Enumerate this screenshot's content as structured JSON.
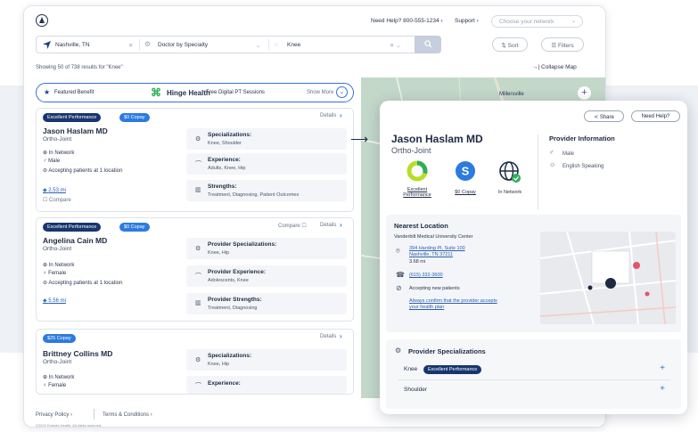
{
  "header": {
    "need_help": "Need Help? 800-555-1234",
    "support": "Support",
    "network_placeholder": "Choose your network"
  },
  "search": {
    "location": "Nashville, TN",
    "type": "Doctor by Specialty",
    "query": "Knee",
    "sort_label": "Sort",
    "filters_label": "Filters"
  },
  "results": {
    "summary": "Showing 50 of 738 results for \"Knee\"",
    "collapse_map": "Collapse Map"
  },
  "featured": {
    "label": "Featured Benefit",
    "brand": "Hinge Health",
    "description": "Free Digital PT Sessions",
    "show_more": "Show More"
  },
  "map": {
    "town": "Millersville"
  },
  "cards": [
    {
      "badges": [
        "Excellent Performance",
        "$0 Copay"
      ],
      "details": "Details",
      "name": "Jason Haslam MD",
      "specialty": "Ortho-Joint",
      "network": "In Network",
      "gender": "Male",
      "accepting": "Accepting patients at 1 location",
      "distance": "2.53 mi",
      "compare": "Compare",
      "spec_title": "Specializations:",
      "spec_val": "Knee, Shoulder",
      "exp_title": "Experience:",
      "exp_val": "Adults, Knee, Hip",
      "str_title": "Strengths:",
      "str_val": "Treatment, Diagnosing, Patient Outcomes"
    },
    {
      "badges": [
        "Excellent Performance",
        "$0 Copay"
      ],
      "details": "Details",
      "compare": "Compare",
      "name": "Angelina Cain MD",
      "specialty": "Ortho-Joint",
      "network": "In Network",
      "gender": "Female",
      "accepting": "Accepting patients at 1 location",
      "distance": "5.56 mi",
      "spec_title": "Provider Specializations:",
      "spec_val": "Knee, Hip",
      "exp_title": "Provider Experience:",
      "exp_val": "Adolescents, Knee",
      "str_title": "Provider Strengths:",
      "str_val": "Treatment, Diagnosing"
    },
    {
      "badges": [
        "$25 Copay"
      ],
      "details": "Details",
      "name": "Brittney Collins MD",
      "specialty": "Ortho-Joint",
      "network": "In Network",
      "gender": "Female",
      "spec_title": "Specializations:",
      "spec_val": "Knee, Hip",
      "exp_title": "Experience:"
    }
  ],
  "footer": {
    "privacy": "Privacy Policy",
    "terms": "Terms & Conditions",
    "copyright": "©2022 Embold Health. All rights reserved."
  },
  "panel": {
    "share": "Share",
    "need_help": "Need Help?",
    "name": "Jason Haslam MD",
    "specialty": "Ortho-Joint",
    "stats": [
      {
        "caption": "Excellent Performance"
      },
      {
        "caption": "$0 Copay"
      },
      {
        "caption": "In Network"
      }
    ],
    "info_title": "Provider Information",
    "gender": "Male",
    "language": "English Speaking",
    "nearest_title": "Nearest Location",
    "center": "Vanderbilt Medical University Center",
    "address1": "394 Harding Pl, Suite 100",
    "address2": "Nashville, TN 37211",
    "distance": "3.68 mi",
    "phone": "(615) 332-3600",
    "accepting": "Accepting new patients",
    "confirm1": "Always confirm that the provider accepts",
    "confirm2": "your health plan",
    "spec_title": "Provider Specializations",
    "spec_rows": [
      {
        "label": "Knee",
        "badge": "Excellent Performance"
      },
      {
        "label": "Shoulder"
      }
    ]
  },
  "colors": {
    "navy": "#18366e",
    "blue": "#2c7be0",
    "hinge_green": "#2fae5a",
    "map_green": "#c3d8c9"
  }
}
